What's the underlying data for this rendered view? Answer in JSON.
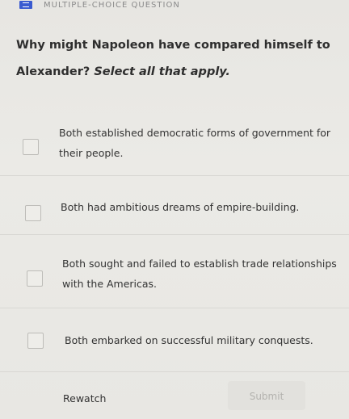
{
  "header": {
    "section_label": "MULTIPLE-CHOICE QUESTION"
  },
  "question": {
    "prompt": "Why might Napoleon have compared himself to Alexander?",
    "instruction": "Select all that apply."
  },
  "options": [
    {
      "label": "Both established democratic forms of government for their people.",
      "checked": false
    },
    {
      "label": "Both had ambitious dreams of empire-building.",
      "checked": false
    },
    {
      "label": "Both sought and failed to establish trade relationships with the Americas.",
      "checked": false
    },
    {
      "label": "Both embarked on successful military conquests.",
      "checked": false
    }
  ],
  "footer": {
    "rewatch_label": "Rewatch",
    "submit_label": "Submit"
  }
}
